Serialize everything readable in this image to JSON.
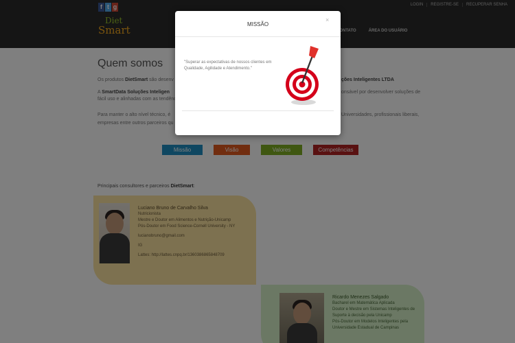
{
  "top_links": [
    "LOGIN",
    "REGISTRE-SE",
    "RECUPERAR SENHA"
  ],
  "logo": {
    "line1": "Diet",
    "line2": "Smart"
  },
  "main_nav": [
    "CONTATO",
    "ÁREA DO USUÁRIO"
  ],
  "page_title": "Quem somos",
  "paragraphs": {
    "p1_start": "Os produtos ",
    "p1_brand": "DietSmart",
    "p1_rest": " são desenv",
    "p1_right": "ções Inteligentes LTDA",
    "p2_start": "A ",
    "p2_brand": "SmartData Soluções Inteligen",
    "p2_right": "onsável por desenvolver soluções de",
    "p3_start": "fácil uso e alinhadas com as tendênc",
    "p4_start": "Para manter o alto nível técnico, é",
    "p4_right": "Universidades, profissionais liberais,",
    "p5_start": "empresas entre outros parceiros qu"
  },
  "tabs": [
    "Missão",
    "Visão",
    "Valores",
    "Competências"
  ],
  "partners": {
    "label": "Principais consultores e parceiros ",
    "brand": "DietSmart",
    "end": ":"
  },
  "card1": {
    "name": "Luciano Bruno de Carvalho Silva",
    "lines": [
      "Nutricionista",
      "Mestre e Doutor em Alimentos e Nutrição-Unicamp",
      "Pós-Doutor em Food Science-Cornell University - NY"
    ],
    "email": "lucianobruno@gmail.com",
    "extra": "IG",
    "lattes": "Lattes: http://lattes.cnpq.br/1360386865848709"
  },
  "card2": {
    "name": "Ricardo Menezes Salgado",
    "lines": [
      "Bacharel em Matemática Aplicada",
      "Doutor e Mestre em Sistemas Inteligentes de",
      "Suporte à decisão pela Unicamp",
      "Pós-Doutor em Modelos Inteligentes pela",
      "Universidade Estadual de Campinas"
    ]
  },
  "modal": {
    "title": "MISSÃO",
    "close": "×",
    "text": "\"Superar as expectativas de nossos clientes em Qualidade, Agilidade e Atendimento.\"",
    "image_icon": "target-with-dart-icon"
  },
  "colors": {
    "tab_missao": "#1f8fc2",
    "tab_visao": "#e35b1e",
    "tab_valores": "#7fae22",
    "tab_competencias": "#b22222"
  }
}
